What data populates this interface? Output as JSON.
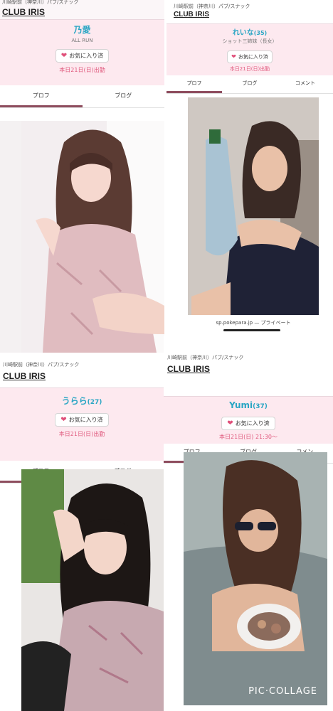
{
  "panels": [
    {
      "location": "川崎駅前（神奈川）パブ/スナック",
      "club": "CLUB IRIS",
      "name": "乃愛",
      "age": "",
      "subtitle": "ALL RUN",
      "favorite_label": "お気に入り済",
      "shift": "本日21日(日)出勤",
      "tabs": [
        "プロフ",
        "ブログ"
      ]
    },
    {
      "location": "川崎駅前（神奈川）パブ/スナック",
      "club": "CLUB IRIS",
      "name": "れいな",
      "age": "(35)",
      "subtitle": "ショット三姉妹（長女）",
      "favorite_label": "お気に入り済",
      "shift": "本日21日(日)出勤",
      "tabs": [
        "プロフ",
        "ブログ",
        "コメント"
      ],
      "footer_url": "sp.pokepara.jp — プライベート"
    },
    {
      "location": "川崎駅前（神奈川）パブ/スナック",
      "club": "CLUB IRIS",
      "name": "うらら",
      "age": "(27)",
      "subtitle": "",
      "favorite_label": "お気に入り済",
      "shift": "本日21日(日)出勤",
      "tabs": [
        "プロフ",
        "ブログ"
      ]
    },
    {
      "location": "川崎駅前（神奈川）パブ/スナック",
      "club": "CLUB IRIS",
      "name": "Yumi",
      "age": "(37)",
      "subtitle": "",
      "favorite_label": "お気に入り済",
      "shift": "本日21日(日) 21:30〜",
      "tabs": [
        "プロフ",
        "ブログ",
        "コメン"
      ]
    }
  ],
  "watermark": "PIC·COLLAGE",
  "icons": {
    "favorite": "heart-icon"
  },
  "colors": {
    "accent": "#e05a7e",
    "name": "#2aa6c4",
    "tab_active": "#8e4d5e",
    "info_bg": "#fde9ef"
  }
}
